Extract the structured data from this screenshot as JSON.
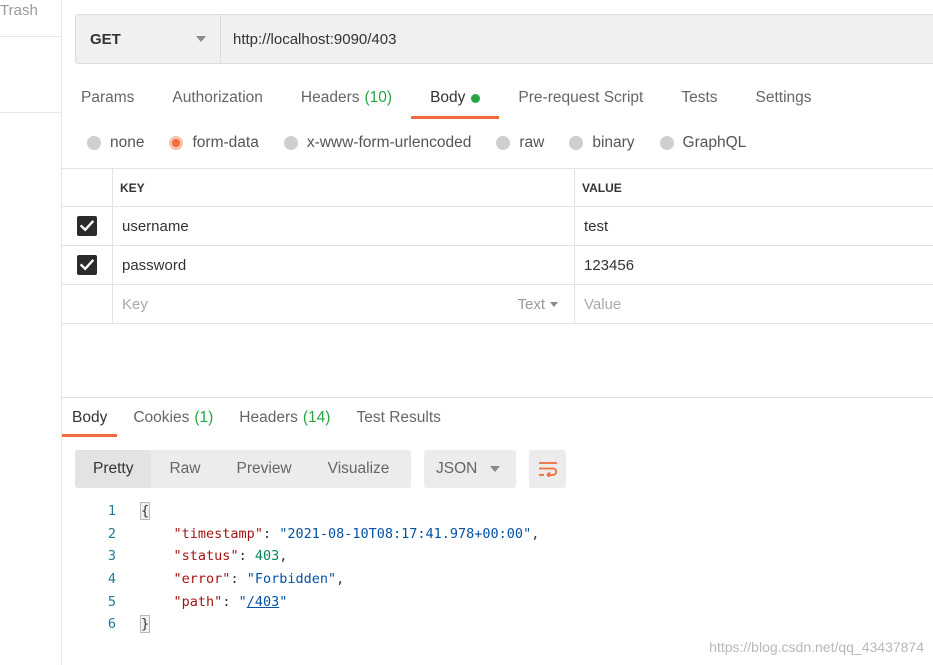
{
  "sidebar": {
    "trash_label": "Trash"
  },
  "request": {
    "method": "GET",
    "url": "http://localhost:9090/403"
  },
  "request_tabs": [
    {
      "label": "Params",
      "count": ""
    },
    {
      "label": "Authorization",
      "count": ""
    },
    {
      "label": "Headers",
      "count": "(10)"
    },
    {
      "label": "Body",
      "count": ""
    },
    {
      "label": "Pre-request Script",
      "count": ""
    },
    {
      "label": "Tests",
      "count": ""
    },
    {
      "label": "Settings",
      "count": ""
    }
  ],
  "body_types": [
    "none",
    "form-data",
    "x-www-form-urlencoded",
    "raw",
    "binary",
    "GraphQL"
  ],
  "selected_body_type": "form-data",
  "kv_table": {
    "headers": {
      "key": "KEY",
      "value": "VALUE"
    },
    "rows": [
      {
        "key": "username",
        "value": "test",
        "checked": true
      },
      {
        "key": "password",
        "value": "123456",
        "checked": true
      }
    ],
    "placeholder": {
      "key": "Key",
      "value": "Value",
      "type": "Text"
    }
  },
  "response_tabs": [
    {
      "label": "Body",
      "count": ""
    },
    {
      "label": "Cookies",
      "count": "(1)"
    },
    {
      "label": "Headers",
      "count": "(14)"
    },
    {
      "label": "Test Results",
      "count": ""
    }
  ],
  "view_modes": [
    "Pretty",
    "Raw",
    "Preview",
    "Visualize"
  ],
  "format": "JSON",
  "code_lines": [
    {
      "num": "1",
      "text": "{"
    },
    {
      "num": "2",
      "key": "timestamp",
      "value": "2021-08-10T08:17:41.978+00:00"
    },
    {
      "num": "3",
      "key": "status",
      "value": "403"
    },
    {
      "num": "4",
      "key": "error",
      "value": "Forbidden"
    },
    {
      "num": "5",
      "key": "path",
      "value": "/403"
    },
    {
      "num": "6",
      "text": "}"
    }
  ],
  "watermark": "https://blog.csdn.net/qq_43437874",
  "colors": {
    "accent": "#f26b3a",
    "count_green": "#26a644"
  },
  "icons": [
    "chevron-down-icon",
    "check-icon",
    "radio-icon",
    "wrap-lines-icon"
  ]
}
